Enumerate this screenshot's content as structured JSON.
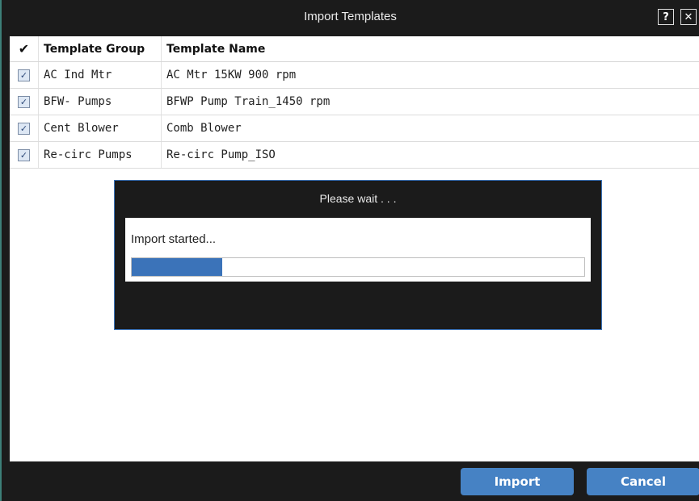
{
  "dialog": {
    "title": "Import Templates",
    "help_label": "?",
    "close_label": "✕"
  },
  "grid": {
    "header": {
      "check_all": "✔",
      "group": "Template Group",
      "name": "Template Name"
    },
    "rows": [
      {
        "checked": true,
        "group": "AC Ind Mtr",
        "name": "AC Mtr 15KW 900 rpm"
      },
      {
        "checked": true,
        "group": "BFW- Pumps",
        "name": "BFWP Pump Train_1450 rpm"
      },
      {
        "checked": true,
        "group": "Cent Blower",
        "name": "Comb Blower"
      },
      {
        "checked": true,
        "group": "Re-circ Pumps",
        "name": "Re-circ Pump_ISO"
      }
    ],
    "check_glyph": "✓"
  },
  "progress_dialog": {
    "title": "Please wait . . .",
    "message": "Import started...",
    "progress_fraction": 0.2
  },
  "footer": {
    "import_label": "Import",
    "cancel_label": "Cancel"
  },
  "colors": {
    "accent": "#4682c4",
    "progress_fill": "#3b73b9",
    "frame": "#1b1b1b"
  }
}
